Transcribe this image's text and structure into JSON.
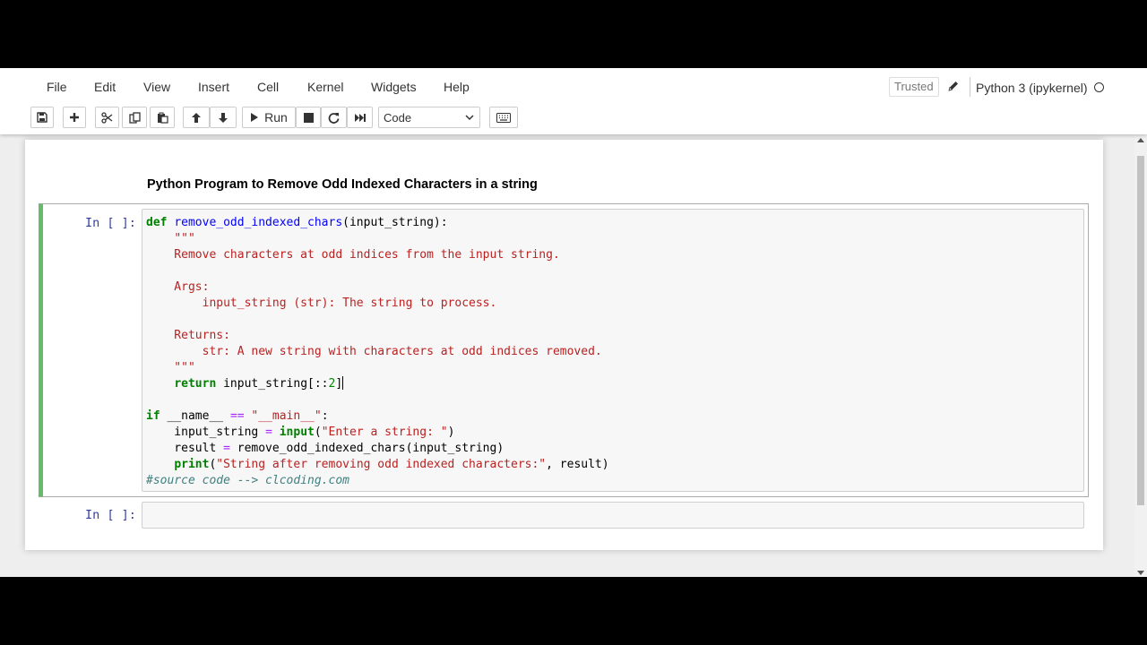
{
  "menu": [
    "File",
    "Edit",
    "View",
    "Insert",
    "Cell",
    "Kernel",
    "Widgets",
    "Help"
  ],
  "status": {
    "trusted": "Trusted",
    "kernel": "Python 3 (ipykernel)"
  },
  "toolbar": {
    "run_label": "Run",
    "cell_type": "Code"
  },
  "icons": [
    "save-icon",
    "plus-icon",
    "cut-icon",
    "copy-icon",
    "paste-icon",
    "arrow-up-icon",
    "arrow-down-icon",
    "play-icon",
    "stop-icon",
    "restart-icon",
    "fast-forward-icon",
    "keyboard-icon",
    "pencil-icon",
    "kernel-idle-icon"
  ],
  "notebook": {
    "heading": "Python Program to Remove Odd Indexed Characters in a string",
    "cells": [
      {
        "prompt": "In [ ]:",
        "lines": [
          "def remove_odd_indexed_chars(input_string):",
          "    \"\"\"",
          "    Remove characters at odd indices from the input string.",
          "",
          "    Args:",
          "        input_string (str): The string to process.",
          "",
          "    Returns:",
          "        str: A new string with characters at odd indices removed.",
          "    \"\"\"",
          "    return input_string[::2]",
          "",
          "if __name__ == \"__main__\":",
          "    input_string = input(\"Enter a string: \")",
          "    result = remove_odd_indexed_chars(input_string)",
          "    print(\"String after removing odd indexed characters:\", result)",
          "#source code --> clcoding.com"
        ]
      },
      {
        "prompt": "In [ ]:",
        "lines": []
      }
    ]
  },
  "colors": {
    "selected_cell_border": "#66bb6a",
    "prompt": "#303f9f",
    "keyword": "#008000",
    "string": "#ba2121",
    "comment": "#408080"
  }
}
